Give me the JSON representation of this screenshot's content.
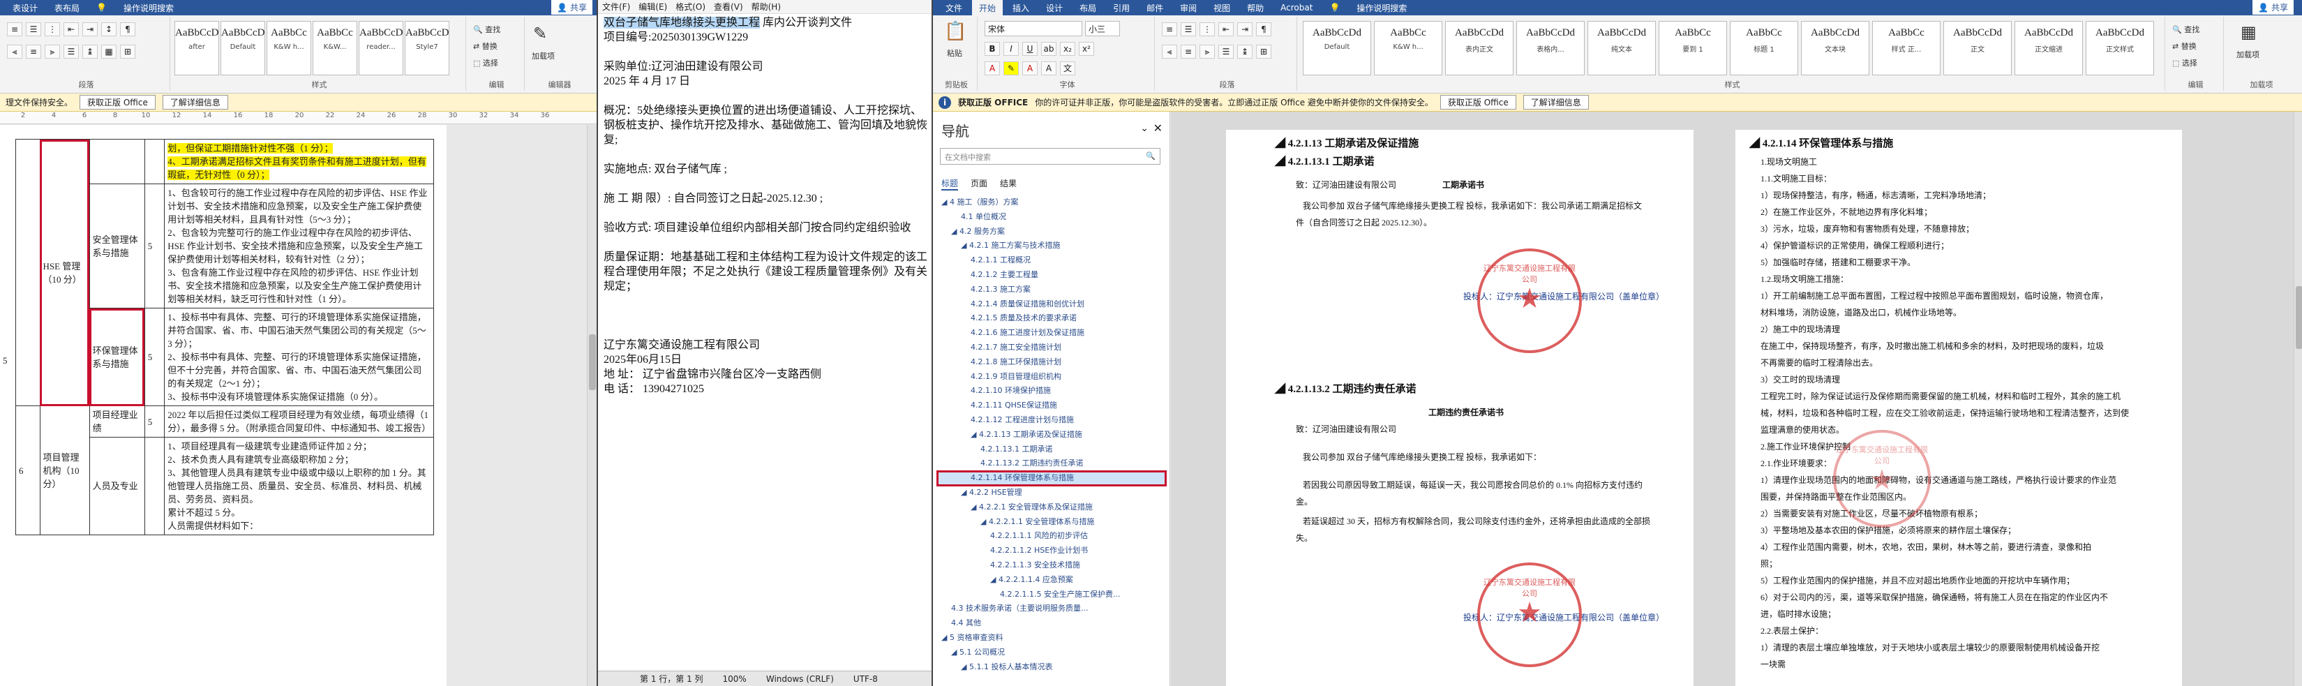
{
  "left": {
    "tabs": [
      "表设计",
      "表布局",
      "操作说明搜索"
    ],
    "share": "共享",
    "styles": [
      {
        "preview": "AaBbCcDc",
        "name": "after"
      },
      {
        "preview": "AaBbCcDc",
        "name": "Default"
      },
      {
        "preview": "AaBbCc",
        "name": "K&W h..."
      },
      {
        "preview": "AaBbCc",
        "name": "K&W..."
      },
      {
        "preview": "AaBbCcDc",
        "name": "reader..."
      },
      {
        "preview": "AaBbCcDc",
        "name": "Style7"
      }
    ],
    "groups": {
      "para": "段落",
      "style": "样式",
      "edit": "编辑",
      "editor": "编辑器"
    },
    "edit_items": [
      "查找",
      "替换",
      "选择"
    ],
    "editor_labels": [
      "加载项",
      "编辑器"
    ],
    "msg": "理文件保持安全。",
    "msg_btn": "获取正版 Office",
    "msg_link": "了解详细信息",
    "ruler": [
      " ",
      "2",
      " ",
      "4",
      " ",
      "6",
      " ",
      "8",
      " ",
      "10",
      " ",
      "12",
      " ",
      "14",
      " ",
      "16",
      " ",
      "18",
      " ",
      "20",
      " ",
      "22",
      " ",
      "24",
      " ",
      "26",
      " ",
      "28",
      " ",
      "30",
      " ",
      "32",
      " ",
      "34",
      " ",
      "36"
    ],
    "rows": {
      "y1": "划，但保证工期措施针对性不强（1 分）；",
      "y2": "4、工期承诺满足招标文件且有奖罚条件和有施工进度计划，但有瑕疵，无针对性（0 分）；",
      "sec_item": "安全管理体系与措施",
      "sec_score": "5",
      "sec_text": [
        "1、包含较可行的施工作业过程中存在风险的初步评估、HSE 作业计划书、安全技术措施和应急预案，以及安全生产施工保护费使用计划等相关材料，且具有针对性（5～3 分）；",
        "2、包含较为完整可行的施工作业过程中存在风险的初步评估、HSE 作业计划书、安全技术措施和应急预案，以及安全生产施工保护费使用计划等相关材料，较有针对性（2 分）；",
        "3、包含有施工作业过程中存在风险的初步评估、HSE 作业计划书、安全技术措施和应急预案，以及安全生产施工保护费使用计划等相关材料，缺乏可行性和针对性（1 分）。"
      ],
      "hse_cat": "HSE 管理（10 分）",
      "hse_no": "5",
      "env_item": "环保管理体系与措施",
      "env_score": "5",
      "env_text": [
        "1、投标书中有具体、完整、可行的环境管理体系实施保证措施，并符合国家、省、市、中国石油天然气集团公司的有关规定（5～3 分）；",
        "2、投标书中有具体、完整、可行的环境管理体系实施保证措施，但不十分完善，并符合国家、省、市、中国石油天然气集团公司的有关规定（2～1 分）；",
        "3、投标书中没有环境管理体系实施保证措施（0 分）。"
      ],
      "pm_item": "项目经理业绩",
      "pm_score": "5",
      "pm_text": "2022 年以后担任过类似工程项目经理为有效业绩，每项业绩得（1 分），最多得 5 分。（附承揽合同复印件、中标通知书、竣工报告）",
      "org_cat": "项目管理机构（10 分）",
      "org_no": "6",
      "staff_item": "人员及专业",
      "staff_text": [
        "1、项目经理具有一级建筑专业建造师证件加 2 分；",
        "2、技术负责人具有建筑专业高级职称加 2 分；",
        "3、其他管理人员具有建筑专业中级或中级以上职称的加 1 分。其他管理人员指施工员、质量员、安全员、标准员、材料员、机械员、劳务员、资料员。",
        "累计不超过 5 分。",
        "人员需提供材料如下："
      ]
    }
  },
  "mid": {
    "menu": [
      "文件(F)",
      "编辑(E)",
      "格式(O)",
      "查看(V)",
      "帮助(H)"
    ],
    "title_sel": "双台子储气库地缘接头更换工程",
    "title_rest": " 库内公开谈判文件",
    "lines": [
      "项目编号:2025030139GW1229",
      "",
      "采购单位:辽河油田建设有限公司",
      " 2025 年 4 月 17 日",
      "",
      "概况：5处绝缘接头更换位置的进出场便道铺设、人工开挖探坑、钢板桩支护、操作坑开挖及排水、基础做施工、管沟回填及地貌恢复;",
      "",
      "实施地点:      双台子储气库                          ;",
      "",
      "施  工  期  限）:      自合同签订之日起-2025.12.30      ;",
      "",
      "验收方式:   项目建设单位组织内部相关部门按合同约定组织验收",
      "",
      "质量保证期：地基基础工程和主体结构工程为设计文件规定的该工程合理使用年限；不足之处执行《建设工程质量管理条例》及有关规定；",
      "",
      "",
      "",
      "辽宁东篱交通设施工程有限公司",
      "2025年06月15日",
      "地    址：  辽宁省盘锦市兴隆台区冷一支路西侧",
      "电    话：  13904271025"
    ],
    "status": [
      "第 1 行，第 1 列",
      "100%",
      "Windows (CRLF)",
      "UTF-8"
    ]
  },
  "right": {
    "tabs": [
      "文件",
      "开始",
      "插入",
      "设计",
      "布局",
      "引用",
      "邮件",
      "审阅",
      "视图",
      "帮助",
      "Acrobat",
      "操作说明搜索"
    ],
    "share": "共享",
    "font": "宋体",
    "size": "小三",
    "styles": [
      {
        "preview": "AaBbCcDd",
        "name": "Default"
      },
      {
        "preview": "AaBbCc",
        "name": "K&W h..."
      },
      {
        "preview": "AaBbCcDd",
        "name": "表内正文"
      },
      {
        "preview": "AaBbCcDd",
        "name": "表格内..."
      },
      {
        "preview": "AaBbCcDd",
        "name": "纯文本"
      },
      {
        "preview": "AaBbCc",
        "name": "要到 1"
      },
      {
        "preview": "AaBbCc",
        "name": "标题 1"
      },
      {
        "preview": "AaBbCcDd",
        "name": "文本块"
      },
      {
        "preview": "AaBbCc",
        "name": "样式 正..."
      },
      {
        "preview": "AaBbCcDd",
        "name": "正文"
      },
      {
        "preview": "AaBbCcDd",
        "name": "正文缩进"
      },
      {
        "preview": "AaBbCcDd",
        "name": "正文样式"
      }
    ],
    "groups": {
      "clip": "剪贴板",
      "font": "字体",
      "para": "段落",
      "style": "样式",
      "edit": "编辑",
      "addin": "加载项"
    },
    "paste": "粘贴",
    "edit_items": [
      "查找",
      "替换",
      "选择"
    ],
    "addin": "加载项",
    "msg_title": "获取正版 OFFICE",
    "msg": "你的许可证并非正版，你可能是盗版软件的受害者。立即通过正版 Office 避免中断并使你的文件保持安全。",
    "msg_btn": "获取正版 Office",
    "msg_link": "了解详细信息",
    "nav": {
      "title": "导航",
      "search": "在文档中搜索",
      "tabs": [
        "标题",
        "页面",
        "结果"
      ],
      "items": [
        {
          "label": "◢ 4 施工（服务）方案",
          "lvl": 0
        },
        {
          "label": "4.1 单位概况",
          "lvl": 2
        },
        {
          "label": "◢ 4.2 服务方案",
          "lvl": 1
        },
        {
          "label": "◢ 4.2.1 施工方案与技术措施",
          "lvl": 2
        },
        {
          "label": "4.2.1.1 工程概况",
          "lvl": 3
        },
        {
          "label": "4.2.1.2 主要工程量",
          "lvl": 3
        },
        {
          "label": "4.2.1.3 施工方案",
          "lvl": 3
        },
        {
          "label": "4.2.1.4 质量保证措施和创优计划",
          "lvl": 3
        },
        {
          "label": "4.2.1.5 质量及技术的要求承诺",
          "lvl": 3
        },
        {
          "label": "4.2.1.6 施工进度计划及保证措施",
          "lvl": 3
        },
        {
          "label": "4.2.1.7 施工安全措施计划",
          "lvl": 3
        },
        {
          "label": "4.2.1.8 施工环保措施计划",
          "lvl": 3
        },
        {
          "label": "4.2.1.9 项目管理组织机构",
          "lvl": 3
        },
        {
          "label": "4.2.1.10 环境保护措施",
          "lvl": 3
        },
        {
          "label": "4.2.1.11 QHSE保证措施",
          "lvl": 3
        },
        {
          "label": "4.2.1.12 工程进度计划与措施",
          "lvl": 3
        },
        {
          "label": "◢ 4.2.1.13 工期承诺及保证措施",
          "lvl": 3
        },
        {
          "label": "4.2.1.13.1 工期承诺",
          "lvl": 4
        },
        {
          "label": "4.2.1.13.2 工期违约责任承诺",
          "lvl": 4
        },
        {
          "label": "4.2.1.14 环保管理体系与措施",
          "lvl": 3,
          "sel": true
        },
        {
          "label": "◢ 4.2.2 HSE管理",
          "lvl": 2
        },
        {
          "label": "◢ 4.2.2.1 安全管理体系及保证措施",
          "lvl": 3
        },
        {
          "label": "◢ 4.2.2.1.1 安全管理体系与措施",
          "lvl": 4
        },
        {
          "label": "4.2.2.1.1.1 风险的初步评估",
          "lvl": 5
        },
        {
          "label": "4.2.2.1.1.2 HSE作业计划书",
          "lvl": 5
        },
        {
          "label": "4.2.2.1.1.3 安全技术措施",
          "lvl": 5
        },
        {
          "label": "◢ 4.2.2.1.1.4 应急预案",
          "lvl": 5
        },
        {
          "label": "4.2.2.1.1.5 安全生产施工保护费...",
          "lvl": 6
        },
        {
          "label": "4.3 技术服务承诺（主要说明服务质量...",
          "lvl": 1
        },
        {
          "label": "4.4 其他",
          "lvl": 1
        },
        {
          "label": "◢ 5 资格审查资料",
          "lvl": 0
        },
        {
          "label": "◢ 5.1 公司概况",
          "lvl": 1
        },
        {
          "label": "◢ 5.1.1 投标人基本情况表",
          "lvl": 2
        }
      ]
    },
    "page1": {
      "h1": "◢ 4.2.1.13 工期承诺及保证措施",
      "h2": "◢ 4.2.1.13.1  工期承诺",
      "to1": "致：辽河油田建设有限公司",
      "title1": "工期承诺书",
      "body1a": "我公司参加 双台子储气库绝缘接头更换工程 投标，我承诺如下：我公司承诺工期满足招标文",
      "body1b": "件（自合同签订之日起 2025.12.30）。",
      "sign1": "投标人：辽宁东篱交通设施工程有限公司（盖单位章）",
      "h3": "◢ 4.2.1.13.2  工期违约责任承诺",
      "title2": "工期违约责任承诺书",
      "to2": "致：辽河油田建设有限公司",
      "body2a": "我公司参加 双台子储气库绝缘接头更换工程 投标，我承诺如下：",
      "body2b": "若因我公司原因导致工期延误，每延误一天，我公司愿按合同总价的 0.1% 向招标方支付违约",
      "body2c": "金。",
      "body2d": "若延误超过 30 天，招标方有权解除合同，我公司除支付违约金外，还将承担由此造成的全部损",
      "body2e": "失。",
      "sign2": "投标人：辽宁东篱交通设施工程有限公司（盖单位章）"
    },
    "stamp_text": "辽宁东篱交通设施工程有限公司",
    "page2": {
      "h1": "◢ 4.2.1.14 环保管理体系与措施",
      "lines": [
        "1.现场文明施工",
        "1.1.文明施工目标：",
        "1）现场保持整洁，有序，畅通，标志清晰，工完料净场地清；",
        "2）在施工作业区外，不就地边界有序化料堆；",
        "3）污水，垃圾，废弃物和有害物质有处理，不随意排放；",
        "4）保护管道标识的正常使用，确保工程顺利进行；",
        "5）加强临时存储，搭建和工棚要求干净。",
        "1.2.现场文明施工措施：",
        "1）开工前编制施工总平面布置图，工程过程中按照总平面布置图规划，临时设施，物资仓库，",
        "材料堆场，消防设施，道路及出口，机械作业场地等。",
        "2）施工中的现场清理",
        "在施工中，保持现场整齐，有序，及时撤出施工机械和多余的材料，及时把现场的废料，垃圾",
        "不再需要的临时工程清除出去。",
        "3）交工时的现场清理",
        "工程完工时，除为保证试运行及保修期而需要保留的施工机械，材料和临时工程外，其余的施工机",
        "械，材料，垃圾和各种临时工程，应在交工验收前运走，保持运输行驶场地和工程清洁整齐，达到使",
        "监理满意的使用状态。",
        "2.施工作业环境保护控制",
        "2.1.作业环境要求：",
        "1）清理作业现场范围内的地面和障碍物，设有交通通道与施工路线，严格执行设计要求的作业范",
        "围要，并保持路面平整在作业范围区内。",
        "2）当需要安装有对施工作业区，尽量不破坏植物原有根系；",
        "3）平整场地及基本农田的保护措施，必须将原来的耕作层土壤保存；",
        "4）工程作业范围内需要，树木，农地，农田，果树，林木等之前，要进行清查，录像和拍",
        "照；",
        "5）工程作业范围内的保护措施，并且不应对超出地质作业地面的开挖坑中车辆作用；",
        "6）对于公司内的污，渠，道等采取保护措施，确保通畅，将有施工人员在在指定的作业区内不",
        "进，临时排水设施；",
        "2.2.表层土保护：",
        "1）清理的表层土壤应单独堆放，对于天地块小或表层土壤较少的原要限制使用机械设备开挖",
        "一块需"
      ]
    }
  }
}
